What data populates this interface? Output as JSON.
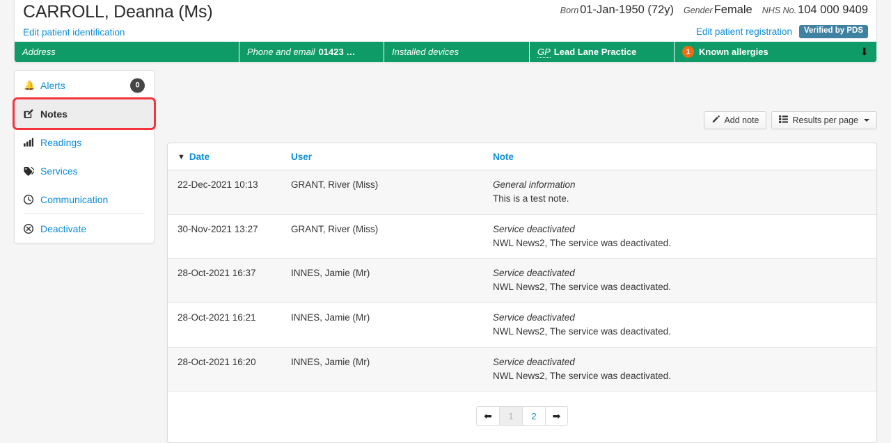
{
  "patient": {
    "name": "CARROLL, Deanna (Ms)",
    "edit_identification_label": "Edit patient identification",
    "edit_registration_label": "Edit patient registration",
    "verified_badge": "Verified by PDS",
    "born_label": "Born",
    "born_value": "01-Jan-1950 (72y)",
    "gender_label": "Gender",
    "gender_value": "Female",
    "nhs_label": "NHS No.",
    "nhs_value": "104 000 9409"
  },
  "summary_bar": {
    "address_label": "Address",
    "phone_label": "Phone and email",
    "phone_value": "01423 …",
    "devices_label": "Installed devices",
    "gp_label": "GP",
    "gp_value": "Lead Lane Practice",
    "allergies_count": "1",
    "allergies_label": "Known allergies",
    "expand_icon": "arrow-down-icon"
  },
  "sidebar": {
    "items": [
      {
        "label": "Alerts",
        "icon": "bell-icon",
        "badge": "0",
        "active": false
      },
      {
        "label": "Notes",
        "icon": "edit-note-icon",
        "active": true
      },
      {
        "label": "Readings",
        "icon": "bar-chart-icon",
        "active": false
      },
      {
        "label": "Services",
        "icon": "tag-icon",
        "active": false
      },
      {
        "label": "Communication",
        "icon": "clock-icon",
        "active": false
      },
      {
        "label": "Deactivate",
        "icon": "cancel-circle-icon",
        "active": false
      }
    ]
  },
  "toolbar": {
    "add_note_label": "Add note",
    "add_note_icon": "pencil-icon",
    "results_per_page_label": "Results per page",
    "results_per_page_icon": "list-icon"
  },
  "notes_table": {
    "columns": [
      "Date",
      "User",
      "Note"
    ],
    "sort_column": "Date",
    "sort_icon": "chevron-down-icon",
    "rows": [
      {
        "date": "22-Dec-2021 10:13",
        "user": "GRANT, River (Miss)",
        "note_title": "General information",
        "note_body": "This is a test note."
      },
      {
        "date": "30-Nov-2021 13:27",
        "user": "GRANT, River (Miss)",
        "note_title": "Service deactivated",
        "note_body": "NWL News2, The service was deactivated."
      },
      {
        "date": "28-Oct-2021 16:37",
        "user": "INNES, Jamie (Mr)",
        "note_title": "Service deactivated",
        "note_body": "NWL News2, The service was deactivated."
      },
      {
        "date": "28-Oct-2021 16:21",
        "user": "INNES, Jamie (Mr)",
        "note_title": "Service deactivated",
        "note_body": "NWL News2, The service was deactivated."
      },
      {
        "date": "28-Oct-2021 16:20",
        "user": "INNES, Jamie (Mr)",
        "note_title": "Service deactivated",
        "note_body": "NWL News2, The service was deactivated."
      }
    ]
  },
  "pagination": {
    "prev_icon": "arrow-left-icon",
    "next_icon": "arrow-right-icon",
    "pages": [
      "1",
      "2"
    ],
    "current_page": "1"
  },
  "colors": {
    "banner_green": "#0f9b68",
    "link_blue": "#0d8ddb",
    "allergy_orange": "#ef6c12",
    "pds_teal": "#3f81a0",
    "highlight_red": "#f4333f",
    "badge_gray": "#464646"
  }
}
